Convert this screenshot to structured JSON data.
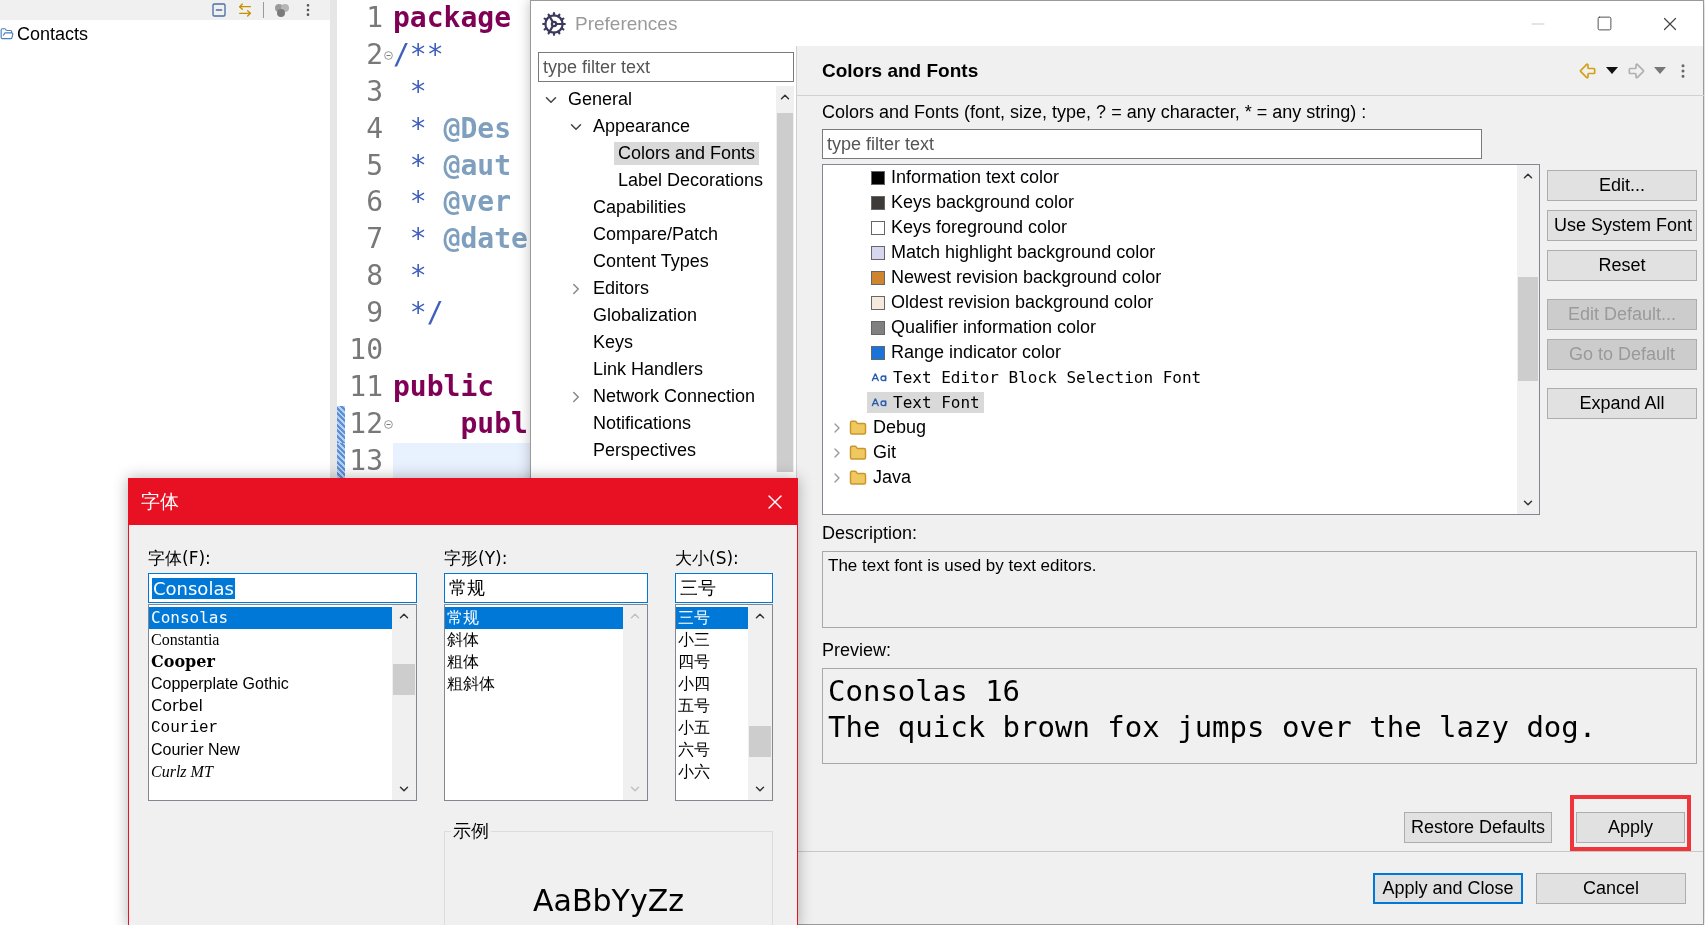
{
  "explorer": {
    "items": [
      {
        "label": "Contacts"
      }
    ]
  },
  "editor": {
    "lines": [
      {
        "number": "1",
        "fold": false,
        "current": false,
        "changed": false,
        "tokens": [
          {
            "kind": "keyword",
            "text": "package"
          }
        ]
      },
      {
        "number": "2",
        "fold": true,
        "current": false,
        "changed": false,
        "tokens": [
          {
            "kind": "doc",
            "text": "/**"
          }
        ]
      },
      {
        "number": "3",
        "fold": false,
        "current": false,
        "changed": false,
        "tokens": [
          {
            "kind": "doc",
            "text": " *"
          }
        ]
      },
      {
        "number": "4",
        "fold": false,
        "current": false,
        "changed": false,
        "tokens": [
          {
            "kind": "doc",
            "text": " * "
          },
          {
            "kind": "tag",
            "text": "@Des"
          }
        ]
      },
      {
        "number": "5",
        "fold": false,
        "current": false,
        "changed": false,
        "tokens": [
          {
            "kind": "doc",
            "text": " * "
          },
          {
            "kind": "tag",
            "text": "@aut"
          }
        ]
      },
      {
        "number": "6",
        "fold": false,
        "current": false,
        "changed": false,
        "tokens": [
          {
            "kind": "doc",
            "text": " * "
          },
          {
            "kind": "tag",
            "text": "@ver"
          }
        ]
      },
      {
        "number": "7",
        "fold": false,
        "current": false,
        "changed": false,
        "tokens": [
          {
            "kind": "doc",
            "text": " * "
          },
          {
            "kind": "tag",
            "text": "@date"
          }
        ]
      },
      {
        "number": "8",
        "fold": false,
        "current": false,
        "changed": false,
        "tokens": [
          {
            "kind": "doc",
            "text": " *"
          }
        ]
      },
      {
        "number": "9",
        "fold": false,
        "current": false,
        "changed": false,
        "tokens": [
          {
            "kind": "doc",
            "text": " */"
          }
        ]
      },
      {
        "number": "10",
        "fold": false,
        "current": false,
        "changed": false
      },
      {
        "number": "11",
        "fold": false,
        "current": false,
        "changed": false,
        "tokens": [
          {
            "kind": "keyword",
            "text": "public"
          }
        ]
      },
      {
        "number": "12",
        "fold": true,
        "current": false,
        "changed": true,
        "tokens": [
          {
            "kind": "keyword",
            "text": "    publ"
          }
        ]
      },
      {
        "number": "13",
        "fold": false,
        "current": true,
        "changed": true
      }
    ]
  },
  "preferences": {
    "title": "Preferences",
    "tree_filter": {
      "placeholder": "type filter text"
    },
    "tree": [
      {
        "label": "General",
        "expanded": true,
        "selected": false,
        "children": [
          {
            "label": "Appearance",
            "expanded": true,
            "selected": false,
            "children": [
              {
                "label": "Colors and Fonts",
                "selected": true
              },
              {
                "label": "Label Decorations",
                "selected": false
              }
            ]
          },
          {
            "label": "Capabilities",
            "selected": false
          },
          {
            "label": "Compare/Patch",
            "selected": false
          },
          {
            "label": "Content Types",
            "selected": false
          },
          {
            "label": "Editors",
            "expanded": false,
            "selected": false
          },
          {
            "label": "Globalization",
            "selected": false
          },
          {
            "label": "Keys",
            "selected": false
          },
          {
            "label": "Link Handlers",
            "selected": false
          },
          {
            "label": "Network Connection",
            "expanded": false,
            "selected": false
          },
          {
            "label": "Notifications",
            "selected": false
          },
          {
            "label": "Perspectives",
            "selected": false
          }
        ]
      }
    ],
    "page": {
      "title": "Colors and Fonts",
      "filter_label": "Colors and Fonts (font, size, type, ? = any character, * = any string) :",
      "filter": {
        "placeholder": "type filter text"
      },
      "items": [
        {
          "kind": "color",
          "label": "Information text color",
          "color": "#000000",
          "selected": false
        },
        {
          "kind": "color",
          "label": "Keys background color",
          "color": "#3d3a38",
          "selected": false
        },
        {
          "kind": "color",
          "label": "Keys foreground color",
          "color": "#ffffff",
          "selected": false
        },
        {
          "kind": "color",
          "label": "Match highlight background color",
          "color": "#d6d6f0",
          "selected": false
        },
        {
          "kind": "color",
          "label": "Newest revision background color",
          "color": "#cf8430",
          "selected": false
        },
        {
          "kind": "color",
          "label": "Oldest revision background color",
          "color": "#f5e8dd",
          "selected": false
        },
        {
          "kind": "color",
          "label": "Qualifier information color",
          "color": "#808080",
          "selected": false
        },
        {
          "kind": "color",
          "label": "Range indicator color",
          "color": "#1a73d9",
          "selected": false
        },
        {
          "kind": "font",
          "label": "Text Editor Block Selection Font",
          "selected": false
        },
        {
          "kind": "font",
          "label": "Text Font",
          "selected": true
        },
        {
          "kind": "category",
          "label": "Debug",
          "expanded": false,
          "selected": false
        },
        {
          "kind": "category",
          "label": "Git",
          "expanded": false,
          "selected": false
        },
        {
          "kind": "category",
          "label": "Java",
          "expanded": false,
          "selected": false
        }
      ],
      "button_groups": [
        {
          "buttons": [
            {
              "label": "Edit...",
              "disabled": false
            },
            {
              "label": "Use System Font",
              "disabled": false
            },
            {
              "label": "Reset",
              "disabled": false
            }
          ]
        },
        {
          "buttons": [
            {
              "label": "Edit Default...",
              "disabled": true
            },
            {
              "label": "Go to Default",
              "disabled": true
            }
          ]
        },
        {
          "buttons": [
            {
              "label": "Expand All",
              "disabled": false
            }
          ]
        }
      ],
      "description_label": "Description:",
      "description": "The text font is used by text editors.",
      "preview_label": "Preview:",
      "preview_lines": [
        "Consolas 16",
        "The quick brown fox jumps over the lazy dog."
      ],
      "actions": [
        {
          "label": "Restore Defaults",
          "highlighted": false
        },
        {
          "label": "Apply",
          "highlighted": true
        }
      ]
    },
    "buttons": [
      {
        "label": "Apply and Close",
        "default": true
      },
      {
        "label": "Cancel",
        "default": false
      }
    ]
  },
  "font_dialog": {
    "title": "字体",
    "columns": [
      {
        "label": "字体(F):",
        "value": "Consolas",
        "value_selected": true,
        "items": [
          {
            "label": "Consolas",
            "kind": "mono",
            "selected": true
          },
          {
            "label": "Constantia",
            "kind": "serif",
            "selected": false
          },
          {
            "label": "Cooper",
            "kind": "heavy",
            "selected": false
          },
          {
            "label": "Copperplate Gothic",
            "kind": "caps",
            "selected": false
          },
          {
            "label": "Corbel",
            "kind": "sans",
            "selected": false
          },
          {
            "label": "Courier",
            "kind": "typewriter",
            "selected": false
          },
          {
            "label": "Courier New",
            "kind": "wide",
            "selected": false
          },
          {
            "label": "Curlz MT",
            "kind": "script",
            "selected": false
          }
        ]
      },
      {
        "label": "字形(Y):",
        "value": "常规",
        "value_selected": false,
        "items": [
          {
            "label": "常规",
            "selected": true
          },
          {
            "label": "斜体",
            "selected": false
          },
          {
            "label": "粗体",
            "selected": false
          },
          {
            "label": "粗斜体",
            "selected": false
          }
        ]
      },
      {
        "label": "大小(S):",
        "value": "三号",
        "value_selected": false,
        "items": [
          {
            "label": "三号",
            "selected": true
          },
          {
            "label": "小三",
            "selected": false
          },
          {
            "label": "四号",
            "selected": false
          },
          {
            "label": "小四",
            "selected": false
          },
          {
            "label": "五号",
            "selected": false
          },
          {
            "label": "小五",
            "selected": false
          },
          {
            "label": "六号",
            "selected": false
          },
          {
            "label": "小六",
            "selected": false
          }
        ]
      }
    ],
    "sample_label": "示例",
    "sample": "AaBbYyZz"
  }
}
